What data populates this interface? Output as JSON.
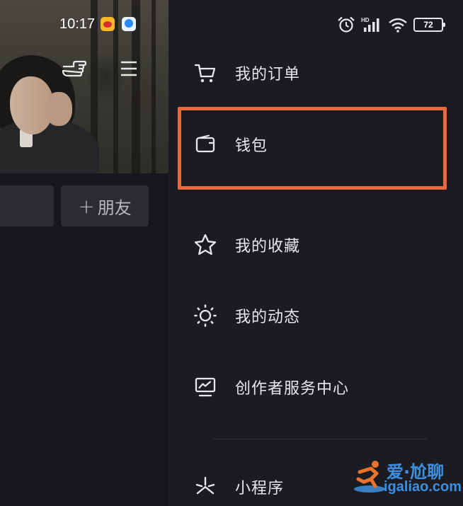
{
  "status_bar": {
    "time": "10:17",
    "battery": "72",
    "network_badge": "HD"
  },
  "profile_page": {
    "add_friend_label": "朋友"
  },
  "drawer": {
    "items": [
      {
        "label": "我的订单",
        "icon": "shopping-cart-icon"
      },
      {
        "label": "钱包",
        "icon": "wallet-icon",
        "highlighted": true
      },
      {
        "label": "我的收藏",
        "icon": "star-icon"
      },
      {
        "label": "我的动态",
        "icon": "sun-icon"
      },
      {
        "label": "创作者服务中心",
        "icon": "creator-center-icon"
      },
      {
        "label": "小程序",
        "icon": "mini-program-icon"
      }
    ]
  },
  "watermark": {
    "title": "爱·尬聊",
    "url": "igaliao.com"
  },
  "colors": {
    "drawer_background": "#1b1c21",
    "highlight_border": "#e86a3a",
    "watermark_blue": "#3f8fe0"
  }
}
